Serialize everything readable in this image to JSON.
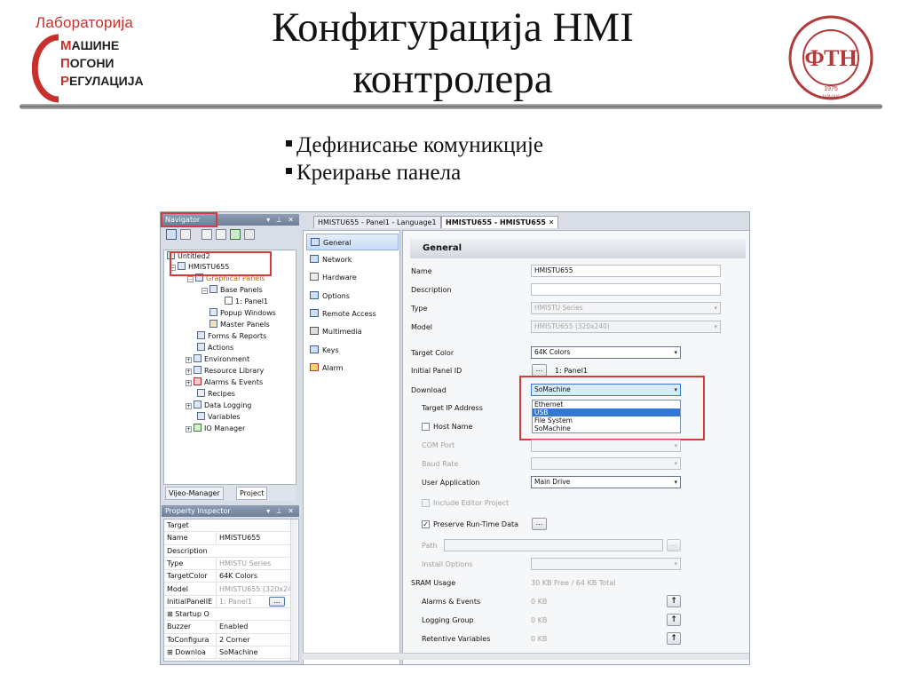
{
  "slide": {
    "logo_left": {
      "line1": "Лабораторија",
      "line2_cap": "М",
      "line2": "АШИНЕ",
      "line3_cap": "П",
      "line3": "ОГОНИ",
      "line4_cap": "Р",
      "line4": "ЕГУЛАЦИЈА"
    },
    "title_line1": "Конфигурација HMI",
    "title_line2": "контролера",
    "bullets": [
      "Дефинисање комуникције",
      "Креирање панела"
    ],
    "seal": {
      "text": "ФАКУЛТЕТ ТЕХНИЧКИХ НАУКА",
      "year": "1975",
      "city": "ЧАЧАК",
      "monogram": "ФТН"
    }
  },
  "app": {
    "navigator": {
      "title": "Navigator",
      "tree": [
        {
          "label": "Untitled2",
          "icon": "project-icon"
        },
        {
          "label": "HMISTU655",
          "icon": "device-icon"
        },
        {
          "label": "Graphical Panels",
          "icon": "panels-icon"
        },
        {
          "label": "Base Panels",
          "icon": "panels-icon"
        },
        {
          "label": "1: Panel1",
          "icon": "panel-icon"
        },
        {
          "label": "Popup Windows",
          "icon": "popup-icon"
        },
        {
          "label": "Master Panels",
          "icon": "master-panel-icon"
        },
        {
          "label": "Forms & Reports",
          "icon": "forms-icon"
        },
        {
          "label": "Actions",
          "icon": "actions-icon"
        },
        {
          "label": "Environment",
          "icon": "environment-icon"
        },
        {
          "label": "Resource Library",
          "icon": "library-icon"
        },
        {
          "label": "Alarms & Events",
          "icon": "alarm-icon"
        },
        {
          "label": "Recipes",
          "icon": "recipe-icon"
        },
        {
          "label": "Data Logging",
          "icon": "logging-icon"
        },
        {
          "label": "Variables",
          "icon": "variables-icon"
        },
        {
          "label": "IO Manager",
          "icon": "io-icon"
        }
      ],
      "tabs": [
        "Vijeo-Manager",
        "Project"
      ]
    },
    "property_inspector": {
      "title": "Property Inspector",
      "rows": [
        {
          "k": "Target",
          "v": ""
        },
        {
          "k": "Name",
          "v": "HMISTU655"
        },
        {
          "k": "Description",
          "v": ""
        },
        {
          "k": "Type",
          "v": "HMISTU Series"
        },
        {
          "k": "TargetColor",
          "v": "64K Colors"
        },
        {
          "k": "Model",
          "v": "HMISTU655 (320x24"
        },
        {
          "k": "InitialPanelIE",
          "v": "1: Panel1"
        },
        {
          "k": "⊞ Startup O",
          "v": ""
        },
        {
          "k": "Buzzer",
          "v": "Enabled"
        },
        {
          "k": "ToConfigura",
          "v": "2 Corner"
        },
        {
          "k": "⊞ Downloa",
          "v": "SoMachine"
        }
      ]
    },
    "doc_tabs": [
      "HMISTU655 - Panel1 - Language1",
      "HMISTU655 - HMISTU655"
    ],
    "categories": [
      {
        "label": "General",
        "icon": "general-icon"
      },
      {
        "label": "Network",
        "icon": "network-icon"
      },
      {
        "label": "Hardware",
        "icon": "hardware-icon"
      },
      {
        "label": "Options",
        "icon": "options-icon"
      },
      {
        "label": "Remote Access",
        "icon": "remote-access-icon"
      },
      {
        "label": "Multimedia",
        "icon": "multimedia-icon"
      },
      {
        "label": "Keys",
        "icon": "keys-icon"
      },
      {
        "label": "Alarm",
        "icon": "alarm-icon"
      }
    ],
    "form": {
      "heading": "General",
      "name_label": "Name",
      "name_value": "HMISTU655",
      "description_label": "Description",
      "description_value": "",
      "type_label": "Type",
      "type_value": "HMISTU Series",
      "model_label": "Model",
      "model_value": "HMISTU655 (320x240)",
      "target_color_label": "Target Color",
      "target_color_value": "64K Colors",
      "initial_panel_label": "Initial Panel ID",
      "initial_panel_value": "1: Panel1",
      "download_label": "Download",
      "download_value": "SoMachine",
      "download_options": [
        "Ethernet",
        "USB",
        "File System",
        "SoMachine"
      ],
      "download_highlighted": "USB",
      "target_ip_label": "Target IP Address",
      "host_name_label": "Host Name",
      "com_port_label": "COM Port",
      "baud_rate_label": "Baud Rate",
      "user_application_label": "User Application",
      "user_application_value": "Main Drive",
      "include_editor_label": "Include Editor Project",
      "preserve_label": "Preserve Run-Time Data",
      "path_label": "Path",
      "install_options_label": "Install Options",
      "sram_label": "SRAM Usage",
      "sram_value": "30 KB Free / 64 KB Total",
      "alarms_label": "Alarms & Events",
      "alarms_value": "0 KB",
      "logging_label": "Logging Group",
      "logging_value": "0 KB",
      "retentive_label": "Retentive Variables",
      "retentive_value": "0 KB",
      "ellipsis": "...",
      "dropdown_arrow": "▾"
    }
  }
}
